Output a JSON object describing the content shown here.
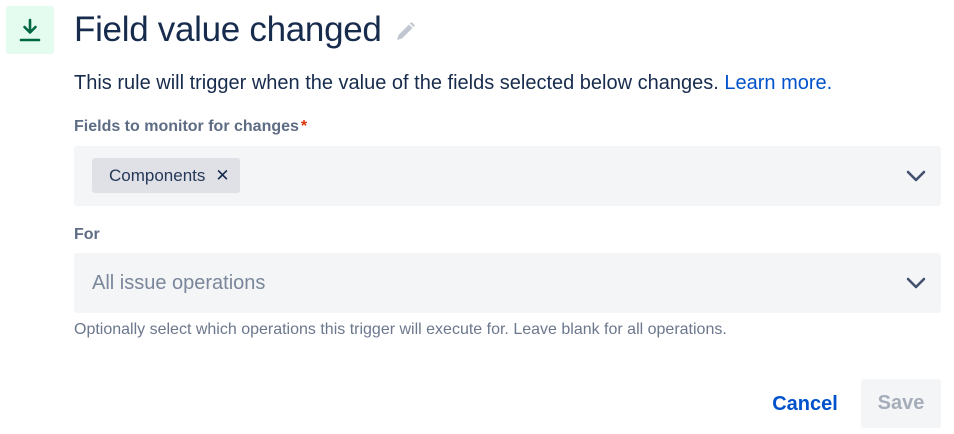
{
  "header": {
    "icon": "download-arrow-icon",
    "title": "Field value changed",
    "edit_icon": "pencil-icon"
  },
  "description": {
    "text": "This rule will trigger when the value of the fields selected below changes.",
    "link": "Learn more."
  },
  "fields_to_monitor": {
    "label": "Fields to monitor for changes",
    "required_marker": "*",
    "selected": [
      {
        "label": "Components",
        "remove_icon": "close-icon"
      }
    ],
    "chevron_icon": "chevron-down-icon"
  },
  "for_field": {
    "label": "For",
    "placeholder": "All issue operations",
    "chevron_icon": "chevron-down-icon",
    "helper": "Optionally select which operations this trigger will execute for. Leave blank for all operations."
  },
  "actions": {
    "cancel_label": "Cancel",
    "save_label": "Save"
  },
  "colors": {
    "icon_bg": "#e3fcef",
    "icon_fg": "#006644",
    "link": "#0052cc",
    "required": "#de350b",
    "field_bg": "#f4f5f7",
    "chip_bg": "#dfe1e6",
    "disabled_text": "#a5adba"
  }
}
